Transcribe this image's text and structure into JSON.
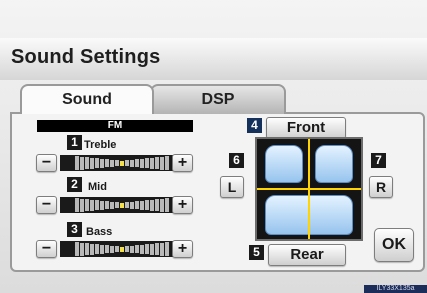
{
  "screen": {
    "title": "Sound Settings",
    "tabs": [
      {
        "label": "Sound",
        "selected": true
      },
      {
        "label": "DSP",
        "selected": false
      }
    ],
    "source": "FM"
  },
  "tone": [
    {
      "marker": "1",
      "label": "Treble",
      "minus": "−",
      "plus": "+",
      "level": 0
    },
    {
      "marker": "2",
      "label": "Mid",
      "minus": "−",
      "plus": "+",
      "level": 0
    },
    {
      "marker": "3",
      "label": "Bass",
      "minus": "−",
      "plus": "+",
      "level": 0
    }
  ],
  "balance": {
    "front_marker": "4",
    "front_label": "Front",
    "rear_marker": "5",
    "rear_label": "Rear",
    "left_marker": "6",
    "left_label": "L",
    "right_marker": "7",
    "right_label": "R"
  },
  "ok_label": "OK",
  "image_code": "ILY33X135a",
  "colors": {
    "meter_active": "#f4e04a",
    "balance_cross": "#ffd400",
    "seat_fill": "#bfdcf6",
    "front_marker_bg": "#14315c"
  }
}
